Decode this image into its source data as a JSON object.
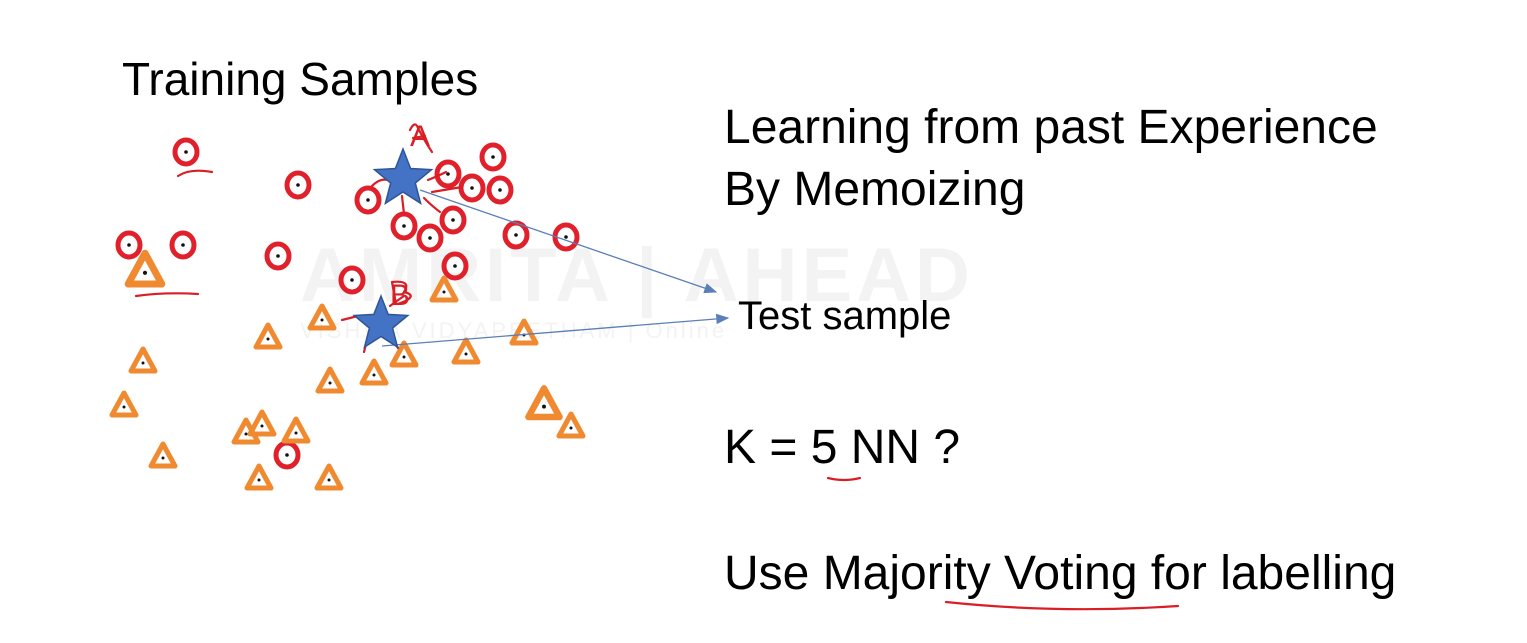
{
  "slide": {
    "title": "Training Samples",
    "heading_line1": "Learning from past Experience",
    "heading_line2": "By Memoizing",
    "test_label": "Test sample",
    "k_text": "K = 5 NN ?",
    "vote_text": "Use Majority Voting for labelling",
    "star_a_label": "A",
    "star_b_label": "B",
    "watermark": "AMRITA | AHEAD",
    "watermark_sub": "VISHWA VIDYAPEETHAM | Online"
  },
  "colors": {
    "circle_class": "#e0202a",
    "triangle_class": "#f08a30",
    "test_star": "#4472c4",
    "arrow": "#5b7fb8",
    "annotation": "#d91e26"
  },
  "icons": {
    "circle_sample": "red-circle-icon",
    "triangle_sample": "orange-triangle-icon",
    "test_star": "blue-star-icon"
  }
}
